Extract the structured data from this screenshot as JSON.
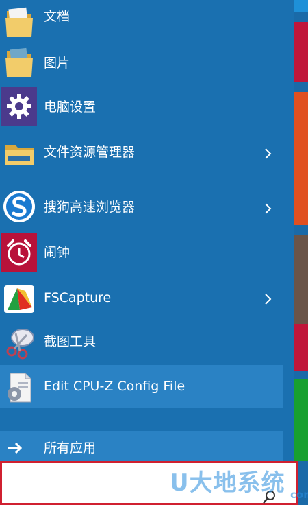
{
  "menu": {
    "items": [
      {
        "label": "文档",
        "icon": "folder-documents-icon",
        "has_submenu": false
      },
      {
        "label": "图片",
        "icon": "folder-pictures-icon",
        "has_submenu": false
      },
      {
        "label": "电脑设置",
        "icon": "gear-icon",
        "has_submenu": false
      },
      {
        "label": "文件资源管理器",
        "icon": "file-explorer-icon",
        "has_submenu": true
      },
      {
        "label": "搜狗高速浏览器",
        "icon": "sogou-browser-icon",
        "has_submenu": true
      },
      {
        "label": "闹钟",
        "icon": "alarm-clock-icon",
        "has_submenu": false
      },
      {
        "label": "FSCapture",
        "icon": "fscapture-icon",
        "has_submenu": true
      },
      {
        "label": "截图工具",
        "icon": "snipping-tool-icon",
        "has_submenu": false
      },
      {
        "label": "Edit CPU-Z Config File",
        "icon": "config-file-icon",
        "has_submenu": false
      }
    ],
    "all_apps_label": "所有应用"
  },
  "search": {
    "value": "",
    "placeholder": ""
  },
  "watermark": {
    "text": "U大地系统",
    "sub": "com"
  },
  "colors": {
    "menu_bg": "#1a70b0",
    "highlight_bg": "#2a82c4",
    "search_border": "#d02030",
    "tiles": [
      "#1e90d8",
      "#c0163a",
      "#e05020",
      "#7a6050",
      "#c0163a",
      "#18a030"
    ]
  }
}
